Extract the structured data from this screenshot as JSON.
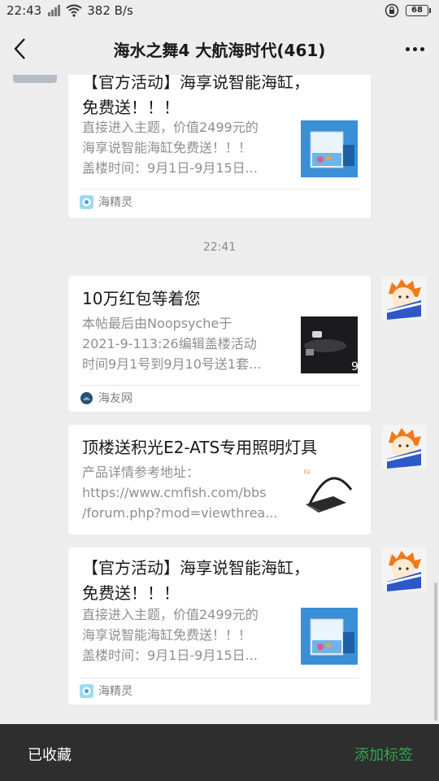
{
  "status_bar": {
    "time": "22:43",
    "network_type": "3G",
    "speed": "382 B/s",
    "battery": "68"
  },
  "nav": {
    "title": "海水之舞4 大航海时代(461)",
    "back_icon": "chevron-left-icon",
    "more_icon": "more-dots-icon"
  },
  "messages": [
    {
      "title_lines": [
        "【官方活动】海享说智能海缸，",
        "免费送！！！"
      ],
      "desc_lines": [
        "直接进入主题，价值2499元的",
        "海享说智能海缸免费送！！！",
        "盖楼时间：9月1日-9月15日..."
      ],
      "source": "海精灵",
      "thumb": "aquarium-tank-image"
    },
    {
      "title_lines": [
        "10万红包等着您"
      ],
      "desc_lines": [
        "本帖最后由Noopsyche于",
        "2021-9-113:26编辑盖楼活动",
        "时间9月1号到9月10号送1套..."
      ],
      "source": "海友网",
      "thumb": "dark-aquarium-image"
    },
    {
      "title_lines": [
        "顶楼送积光E2-ATS专用照明灯具"
      ],
      "desc_lines": [
        "产品详情参考地址：",
        "https://www.cmfish.com/bbs",
        "/forum.php?mod=viewthrea..."
      ],
      "source": "",
      "thumb": "light-fixture-image"
    },
    {
      "title_lines": [
        "【官方活动】海享说智能海缸，",
        "免费送！！！"
      ],
      "desc_lines": [
        "直接进入主题，价值2499元的",
        "海享说智能海缸免费送！！！",
        "盖楼时间：9月1日-9月15日..."
      ],
      "source": "海精灵",
      "thumb": "aquarium-tank-image"
    }
  ],
  "timestamp": "22:41",
  "bottom_bar": {
    "left_label": "已收藏",
    "right_label": "添加标签"
  },
  "colors": {
    "background": "#ededed",
    "card": "#ffffff",
    "bottom_bar": "#2e2e2e",
    "accent_green": "#2fa84f"
  }
}
